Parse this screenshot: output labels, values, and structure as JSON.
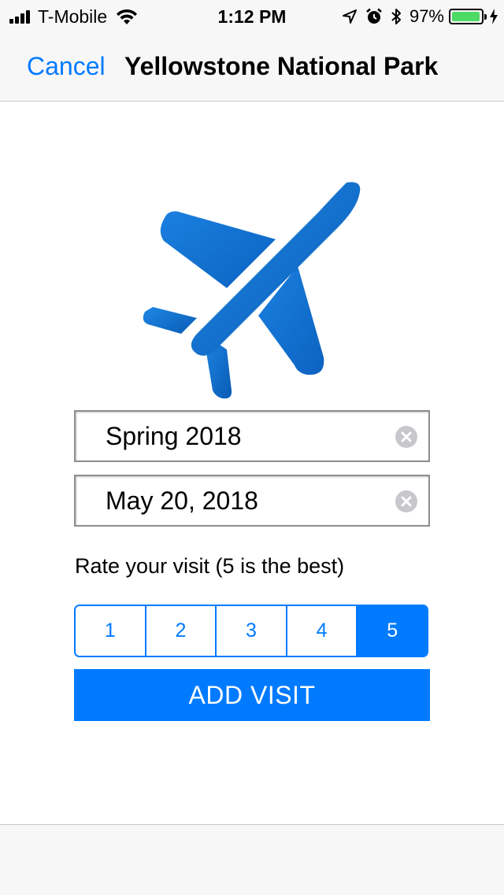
{
  "status_bar": {
    "carrier": "T-Mobile",
    "time": "1:12 PM",
    "battery_percent": "97%",
    "battery_level": 0.97,
    "icons": [
      "signal-icon",
      "wifi-icon",
      "location-arrow-icon",
      "alarm-icon",
      "bluetooth-icon",
      "battery-icon",
      "charging-icon"
    ]
  },
  "nav": {
    "cancel_label": "Cancel",
    "title": "Yellowstone National Park"
  },
  "hero_icon": "airplane-icon",
  "form": {
    "season_value": "Spring 2018",
    "date_value": "May 20, 2018",
    "rate_label": "Rate your visit (5 is the best)",
    "ratings": [
      "1",
      "2",
      "3",
      "4",
      "5"
    ],
    "selected_rating": "5",
    "submit_label": "ADD VISIT"
  },
  "colors": {
    "accent": "#007aff",
    "plane_light": "#1e88e5",
    "plane_dark": "#0d5fb8",
    "battery_fill": "#4cd964"
  }
}
